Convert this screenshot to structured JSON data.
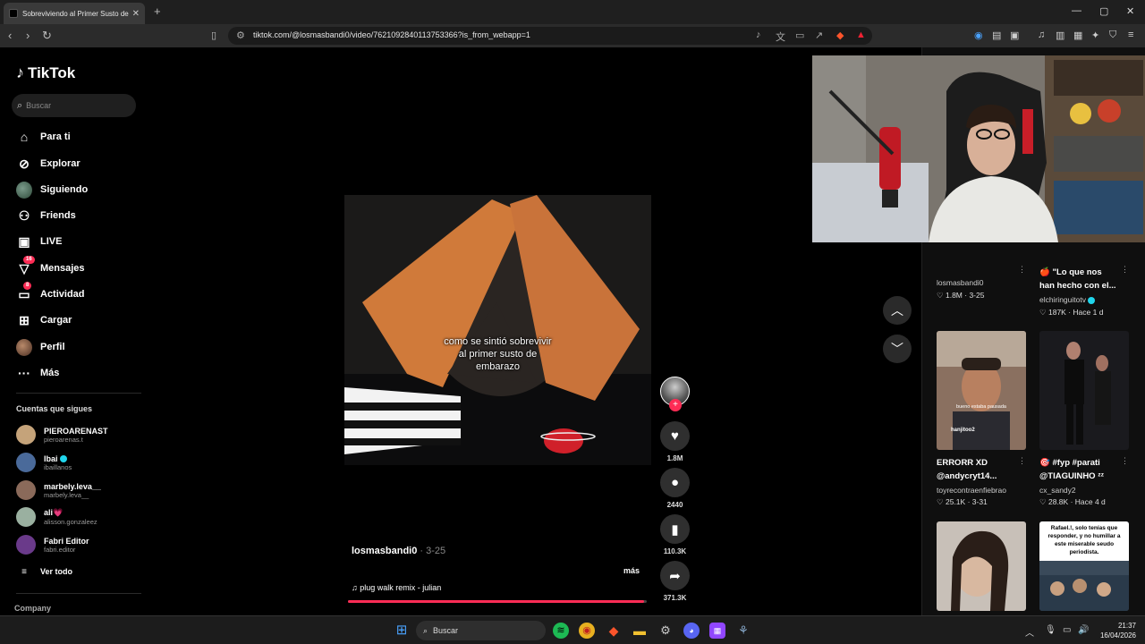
{
  "browser": {
    "tab_title": "Sobreviviendo al Primer Susto de",
    "tab_close": "✕",
    "new_tab": "+",
    "url": "tiktok.com/@losmasbandi0/video/7621092840113753366?is_from_webapp=1",
    "window_controls": {
      "minimize": "—",
      "maximize": "▢",
      "close": "✕"
    }
  },
  "sidebar": {
    "logo": "TikTok",
    "search_placeholder": "Buscar",
    "nav": [
      {
        "label": "Para ti",
        "icon": "home-icon"
      },
      {
        "label": "Explorar",
        "icon": "compass-icon"
      },
      {
        "label": "Siguiendo",
        "icon": "following-avatar"
      },
      {
        "label": "Friends",
        "icon": "friends-icon"
      },
      {
        "label": "LIVE",
        "icon": "live-icon"
      },
      {
        "label": "Mensajes",
        "icon": "messages-icon",
        "badge": "16"
      },
      {
        "label": "Actividad",
        "icon": "activity-icon",
        "badge": "8"
      },
      {
        "label": "Cargar",
        "icon": "upload-icon"
      },
      {
        "label": "Perfil",
        "icon": "profile-avatar"
      },
      {
        "label": "Más",
        "icon": "more-icon"
      }
    ],
    "following_title": "Cuentas que sigues",
    "following": [
      {
        "name": "PIEROARENAST",
        "handle": "pieroarenas.t",
        "color": "#c5a37a"
      },
      {
        "name": "Ibai",
        "handle": "ibaillanos",
        "color": "#4a6a9a",
        "verified": true
      },
      {
        "name": "marbely.leva__",
        "handle": "marbely.leva__",
        "color": "#8a6a5a"
      },
      {
        "name": "ali",
        "handle": "alisson.gonzaleez",
        "color": "#9ab0a0",
        "heart": "💗"
      },
      {
        "name": "Fabri Editor",
        "handle": "fabri.editor",
        "color": "#6a3a8a"
      }
    ],
    "see_all": "Ver todo",
    "company": "Company"
  },
  "video": {
    "caption_lines": [
      "como se sintió sobrevivir",
      "al primer susto de",
      "embarazo"
    ],
    "author": "losmasbandi0",
    "date": "3-25",
    "more": "más",
    "music": "plug walk remix - julian",
    "progress": 0.99,
    "likes": "1.8M",
    "comments": "2440",
    "saves": "110.3K",
    "shares": "371.3K"
  },
  "related": [
    {
      "title": "",
      "author": "losmasbandi0",
      "likes": "1.8M",
      "date": "3-25"
    },
    {
      "title_line1": "🍎 \"Lo que nos",
      "title_line2": "han hecho con el...",
      "author": "elchiringuitotv",
      "likes": "187K",
      "date": "Hace 1 d"
    },
    {
      "title_line1": "ERRORR XD",
      "title_line2": "@andycryt14...",
      "author": "toyrecontraenfiebrao",
      "likes": "25.1K",
      "date": "3-31",
      "overlay_user": "hanjitoo2",
      "overlay_text": "bueno estaba pausada"
    },
    {
      "title_line1": "🎯 #fyp #parati",
      "title_line2": "@TIAGUINHO ᶻᶻ",
      "author": "cx_sandy2",
      "likes": "28.8K",
      "date": "Hace 4 d"
    },
    {
      "thumb_text": "Rafael.!, solo tenías que responder, y no humillar a este miserable seudo periodista."
    }
  ],
  "taskbar": {
    "search": "Buscar",
    "time": "21:37",
    "date": "16/04/2026"
  },
  "colors": {
    "accent": "#fe2c55",
    "bg": "#000000",
    "panel": "#0f0f0f"
  }
}
